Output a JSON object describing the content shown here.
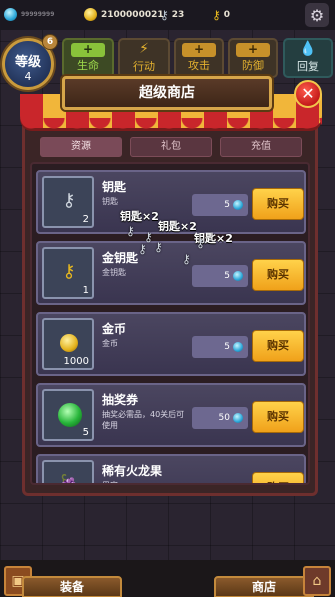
{
  "topbar": {
    "gems": "99999999",
    "gold": "2100000021",
    "silver_keys": "23",
    "gold_keys": "0"
  },
  "level": {
    "label": "等级",
    "value": "4",
    "badge": "6"
  },
  "stats": {
    "hp": {
      "symbol": "+",
      "label": "生命"
    },
    "action": {
      "symbol": "⚡",
      "label": "行动"
    },
    "attack": {
      "symbol": "+",
      "label": "攻击"
    },
    "defense": {
      "symbol": "+",
      "label": "防御"
    },
    "heal": {
      "symbol": "💧",
      "label": "回复"
    }
  },
  "shop": {
    "title": "超级商店",
    "close": "✕",
    "tabs": [
      "资源",
      "礼包",
      "充值"
    ],
    "items": [
      {
        "name": "钥匙",
        "desc": "钥匙",
        "qty": "2",
        "price": "5",
        "buy": "购买",
        "icon": "silver-key"
      },
      {
        "name": "金钥匙",
        "desc": "金钥匙",
        "qty": "1",
        "price": "5",
        "buy": "购买",
        "icon": "gold-key"
      },
      {
        "name": "金币",
        "desc": "金币",
        "qty": "1000",
        "price": "5",
        "buy": "购买",
        "icon": "coin"
      },
      {
        "name": "抽奖券",
        "desc": "抽奖必需品，40关后可使用",
        "qty": "5",
        "price": "50",
        "buy": "购买",
        "icon": "green-orb"
      },
      {
        "name": "稀有火龙果",
        "desc": "果实",
        "qty": "",
        "price": "",
        "buy": "购买",
        "icon": "dragonfruit"
      }
    ],
    "floaters": [
      "钥匙×2",
      "钥匙×2",
      "钥匙×2"
    ]
  },
  "bottom": {
    "equip": "装备",
    "shop": "商店"
  }
}
